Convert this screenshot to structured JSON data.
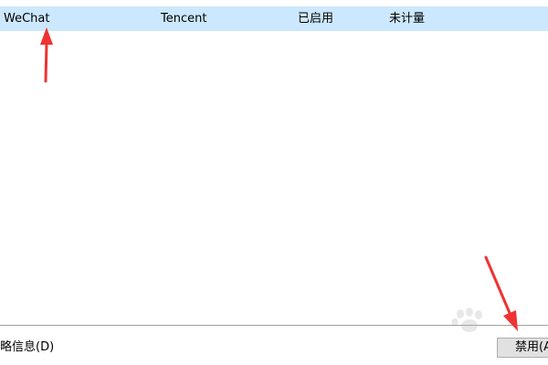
{
  "startup_list": {
    "rows": [
      {
        "name": "WeChat",
        "publisher": "Tencent",
        "status": "已启用",
        "impact": "未计量"
      }
    ]
  },
  "footer": {
    "details_label": "略信息(D)",
    "disable_label": "禁用(A"
  },
  "annotations": {
    "arrow_color": "#ee3333"
  },
  "selection_color": "#cce8ff"
}
